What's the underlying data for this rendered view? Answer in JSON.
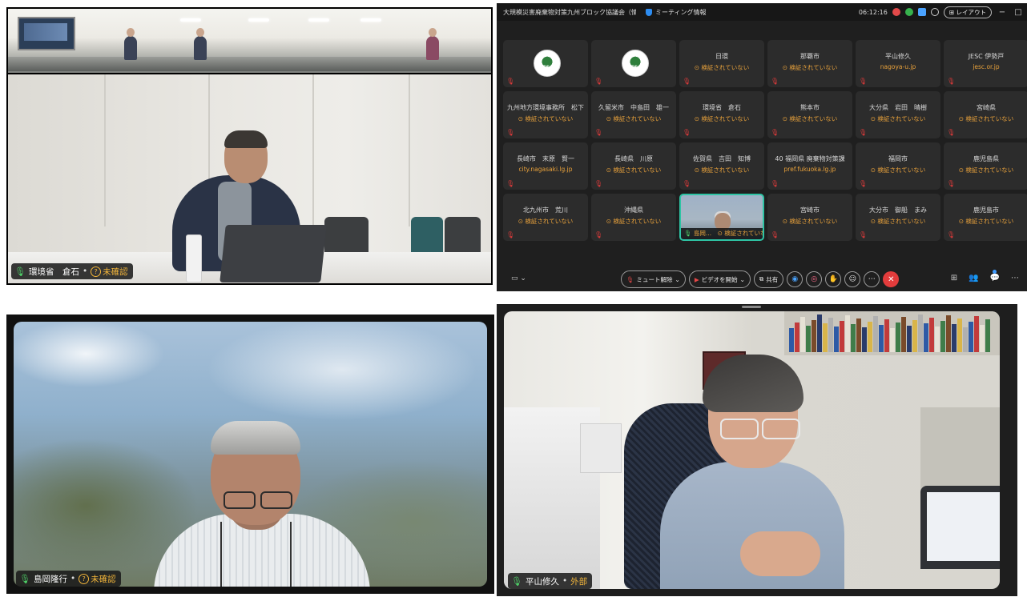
{
  "panel1": {
    "name": "環境省　倉石",
    "status": "未確認"
  },
  "panel2": {
    "title": "大規模災害廃棄物対策九州ブロック協議会（情報伝...",
    "meeting_info": "ミーティング情報",
    "time": "06:12:16",
    "layout": "レイアウト",
    "tiles": [
      {
        "name": "",
        "status": "",
        "logo": "JESC"
      },
      {
        "name": "",
        "status": "",
        "logo": "JESC"
      },
      {
        "name": "日環",
        "status": "⊙ 検証されていない"
      },
      {
        "name": "那覇市",
        "status": "⊙ 検証されていない"
      },
      {
        "name": "平山修久",
        "status": "nagoya-u.jp"
      },
      {
        "name": "JESC 伊勢戸",
        "status": "jesc.or.jp"
      },
      {
        "name": "九州地方環境事務所　松下",
        "status": "⊙ 検証されていない"
      },
      {
        "name": "久留米市　中島田　雄一",
        "status": "⊙ 検証されていない"
      },
      {
        "name": "環境省　倉石",
        "status": "⊙ 検証されていない"
      },
      {
        "name": "熊本市",
        "status": "⊙ 検証されていない"
      },
      {
        "name": "大分県　岩田　晴樹",
        "status": "⊙ 検証されていない"
      },
      {
        "name": "宮崎県",
        "status": "⊙ 検証されていない"
      },
      {
        "name": "長崎市　末原　賢一",
        "status": "city.nagasaki.lg.jp"
      },
      {
        "name": "長崎県　川原",
        "status": "⊙ 検証されていない"
      },
      {
        "name": "佐賀県　吉田　知博",
        "status": "⊙ 検証されていない"
      },
      {
        "name": "40 福岡県 廃棄物対策課",
        "status": "pref.fukuoka.lg.jp"
      },
      {
        "name": "福岡市",
        "status": "⊙ 検証されていない"
      },
      {
        "name": "鹿児島県",
        "status": "⊙ 検証されていない"
      },
      {
        "name": "北九州市　荒川",
        "status": "⊙ 検証されていない"
      },
      {
        "name": "沖縄県",
        "status": "⊙ 検証されていない"
      },
      {
        "name": "",
        "status": "島岡...　⊙ 検証されていない",
        "active": true
      },
      {
        "name": "宮崎市",
        "status": "⊙ 検証されていない"
      },
      {
        "name": "大分市　御船　まみ",
        "status": "⊙ 検証されていない"
      },
      {
        "name": "鹿児島市",
        "status": "⊙ 検証されていない"
      }
    ],
    "controls": {
      "unmute": "ミュート解除",
      "start_video": "ビデオを開始",
      "share": "共有"
    }
  },
  "panel3": {
    "name": "島岡隆行",
    "status": "未確認"
  },
  "panel4": {
    "name": "平山修久",
    "status": "外部"
  }
}
